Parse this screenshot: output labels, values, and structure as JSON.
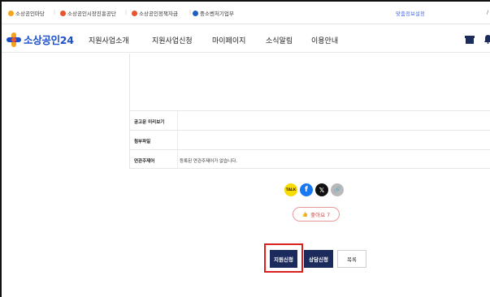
{
  "topbar": {
    "sites": [
      "소상공인마당",
      "소상공인시장진흥공단",
      "소상공인정책자금",
      "중소벤처기업부"
    ],
    "right_link": "맞춤정보설정",
    "edge_mark": "/"
  },
  "logo": {
    "text": "소상공인24"
  },
  "nav": {
    "items": [
      "지원사업소개",
      "지원사업신청",
      "마이페이지",
      "소식알림",
      "이용안내"
    ]
  },
  "details": {
    "rows": [
      {
        "label": "공고문 미리보기",
        "value": ""
      },
      {
        "label": "첨부파일",
        "value": ""
      },
      {
        "label": "연관주제어",
        "value": "등록된 연관주제어가 없습니다."
      }
    ]
  },
  "share": {
    "kakao": "TALK",
    "facebook": "f",
    "x": "𝕏",
    "link": "🔗"
  },
  "like": {
    "label": "좋아요 7"
  },
  "buttons": {
    "apply": "지원신청",
    "consult": "상담신청",
    "list": "목록"
  },
  "colors": {
    "brand_blue": "#1b4ec9",
    "navy_button": "#1a2b5c",
    "highlight_red": "#d9201f"
  }
}
